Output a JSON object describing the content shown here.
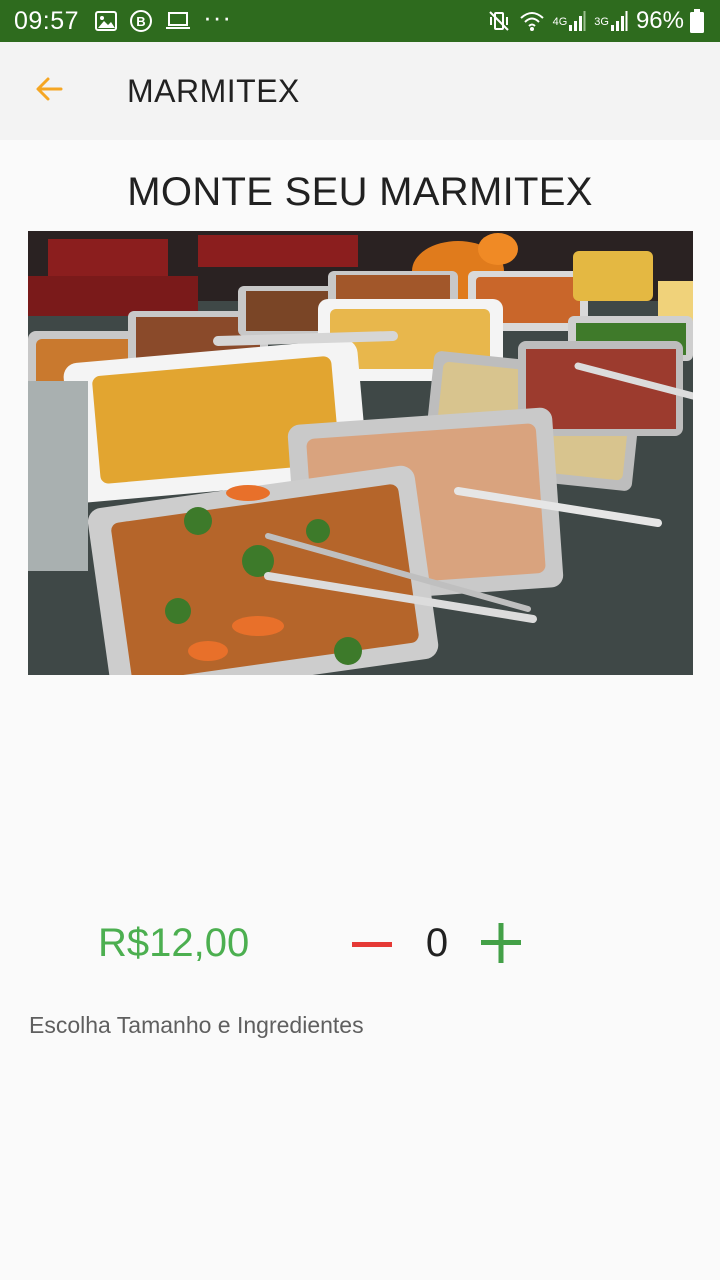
{
  "status_bar": {
    "time": "09:57",
    "net_primary": "4G",
    "net_secondary": "3G",
    "battery": "96%",
    "overflow": "···",
    "left_icons": [
      "image-icon",
      "b-circle-icon",
      "laptop-icon",
      "more-icon"
    ],
    "right_icons": [
      "mute-vibrate-icon",
      "wifi-icon",
      "signal-icon",
      "signal-icon",
      "battery-icon"
    ]
  },
  "app_bar": {
    "title": "MARMITEX",
    "back_icon": "arrow-left-icon",
    "accent_color": "#f5a623",
    "background": "#f3f3f3"
  },
  "content": {
    "heading": "MONTE SEU MARMITEX",
    "image": "buffet-food-photo",
    "price": "R$12,00",
    "quantity": "0",
    "hint": "Escolha Tamanho e Ingredientes"
  },
  "colors": {
    "status_bar": "#2e6b1e",
    "price": "#4caf50",
    "minus": "#e53935",
    "plus": "#43a047"
  }
}
